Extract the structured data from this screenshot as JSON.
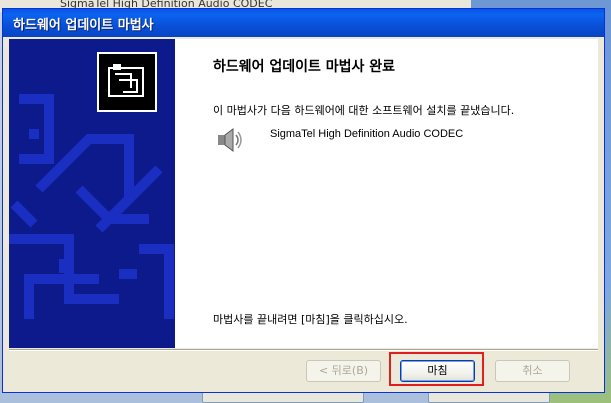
{
  "background": {
    "title_fragment": "SigmaTel High Definition Audio CODEC"
  },
  "dialog": {
    "title": "하드웨어 업데이트 마법사",
    "heading": "하드웨어 업데이트 마법사 완료",
    "description": "이 마법사가 다음 하드웨어에 대한 소프트웨어 설치를 끝냈습니다.",
    "device_icon": "speaker-icon",
    "device_name": "SigmaTel High Definition Audio CODEC",
    "finish_hint": "마법사를 끝내려면 [마침]을 클릭하십시오.",
    "buttons": {
      "back": "< 뒤로(B)",
      "finish": "마침",
      "cancel": "취소"
    },
    "accent_color": "#0a55e6",
    "highlight_color": "#e02020"
  }
}
